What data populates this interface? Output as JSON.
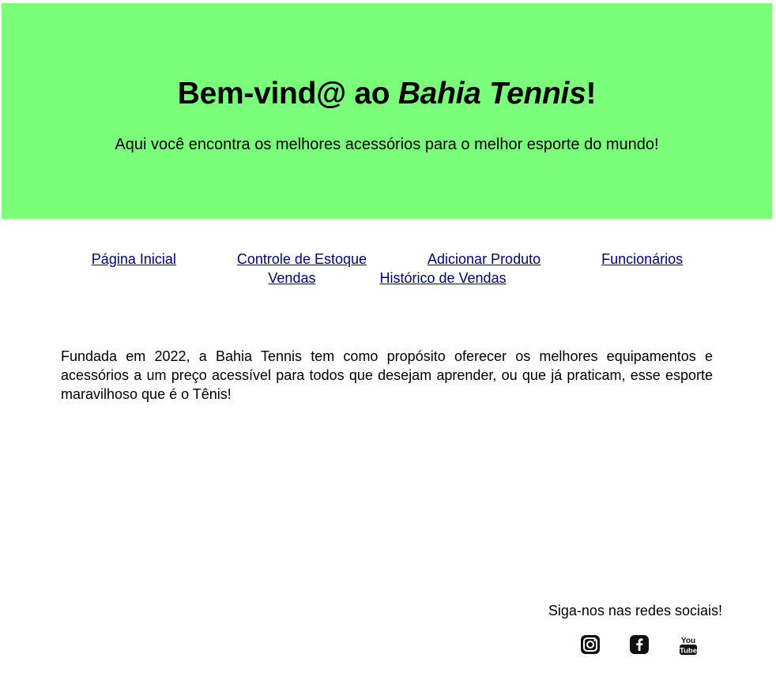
{
  "header": {
    "title_prefix": "Bem-vind@ ao ",
    "title_brand": "Bahia Tennis",
    "title_suffix": "!",
    "subtitle": "Aqui você encontra os melhores acessórios para o melhor esporte do mundo!",
    "background_color": "#7bff7b"
  },
  "nav": {
    "items": [
      {
        "label": "Página Inicial "
      },
      {
        "label": "Controle de Estoque "
      },
      {
        "label": "Adicionar Produto "
      },
      {
        "label": "Funcionários"
      },
      {
        "label": "Vendas"
      },
      {
        "label": "Histórico de Vendas"
      }
    ],
    "link_color": "#000080"
  },
  "about": {
    "text": "Fundada em 2022, a Bahia Tennis tem como propósito oferecer os melhores equipamentos e acessórios a um preço acessível para todos que desejam aprender, ou que já praticam, esse esporte maravilhoso que é o Tênis!"
  },
  "footer": {
    "social_heading": "Siga-nos nas redes sociais!",
    "icons": [
      {
        "name": "instagram-icon"
      },
      {
        "name": "facebook-icon"
      },
      {
        "name": "youtube-icon",
        "text_top": "You",
        "text_bottom": "Tube"
      }
    ]
  }
}
